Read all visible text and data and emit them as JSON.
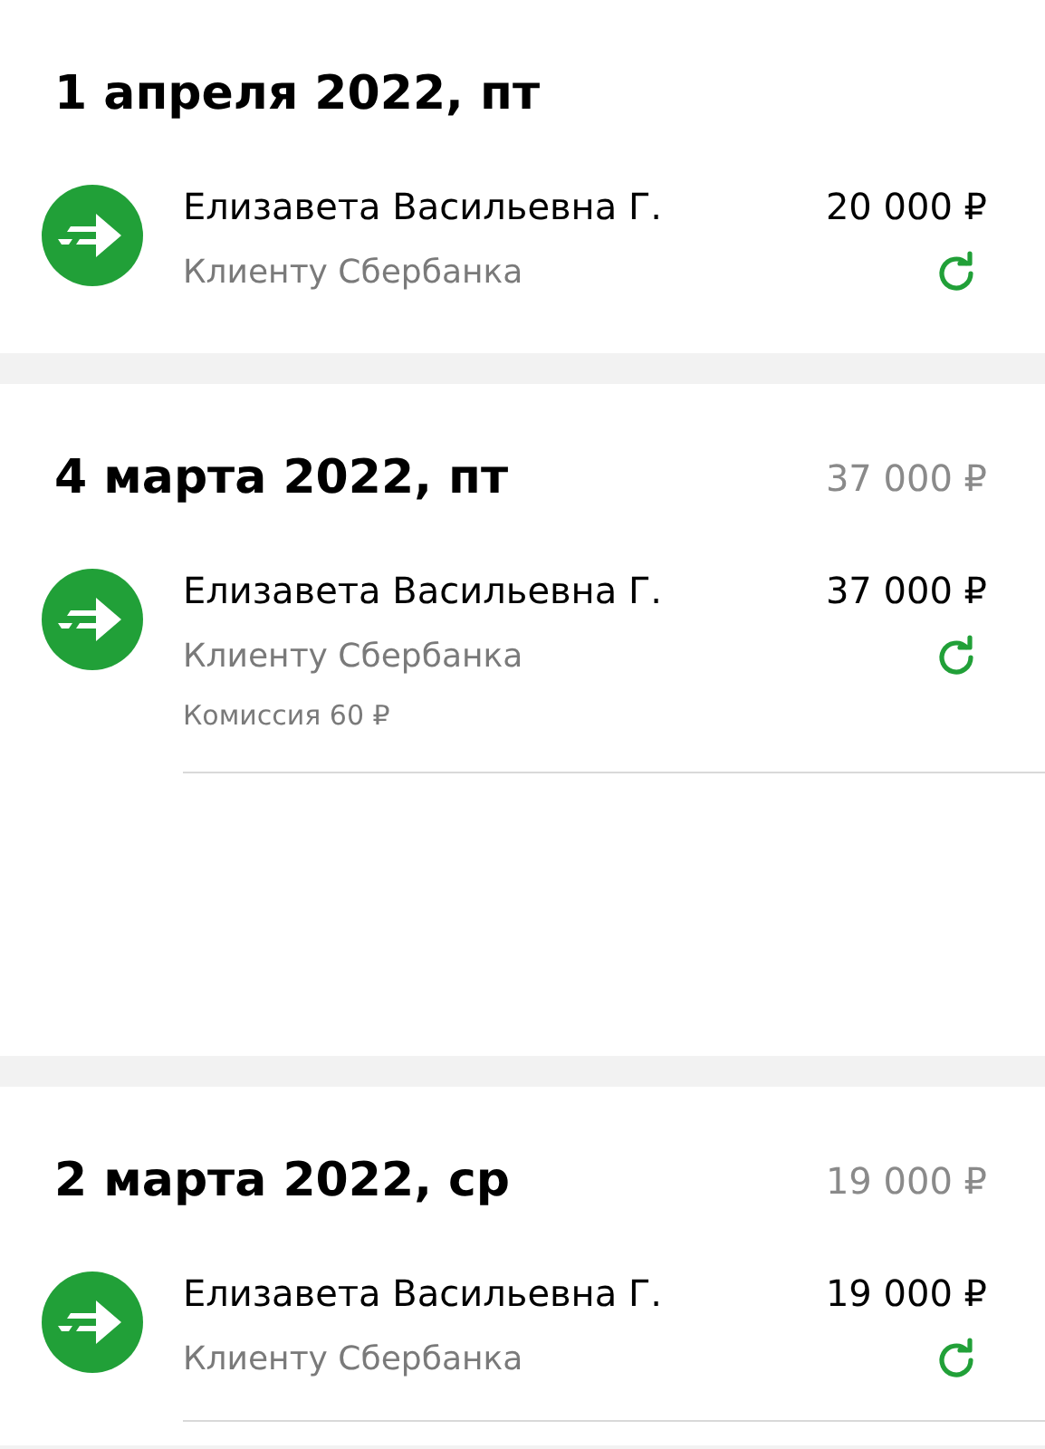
{
  "sections": [
    {
      "date": "1 апреля 2022, пт",
      "items": [
        {
          "name": "Елизавета Васильевна Г.",
          "subtitle": "Клиенту Сбербанка",
          "amount": "20 000 ₽",
          "divider": false
        }
      ]
    },
    {
      "date": "4 марта 2022, пт",
      "total": "37 000 ₽",
      "items": [
        {
          "name": "Елизавета Васильевна Г.",
          "subtitle": "Клиенту Сбербанка",
          "amount": "37 000 ₽",
          "commission": "Комиссия 60 ₽",
          "divider": true
        }
      ]
    },
    {
      "date": "2 марта 2022, ср",
      "total": "19 000 ₽",
      "items": [
        {
          "name": "Елизавета Васильевна Г.",
          "subtitle": "Клиенту Сбербанка",
          "amount": "19 000 ₽",
          "divider": true
        }
      ]
    }
  ]
}
